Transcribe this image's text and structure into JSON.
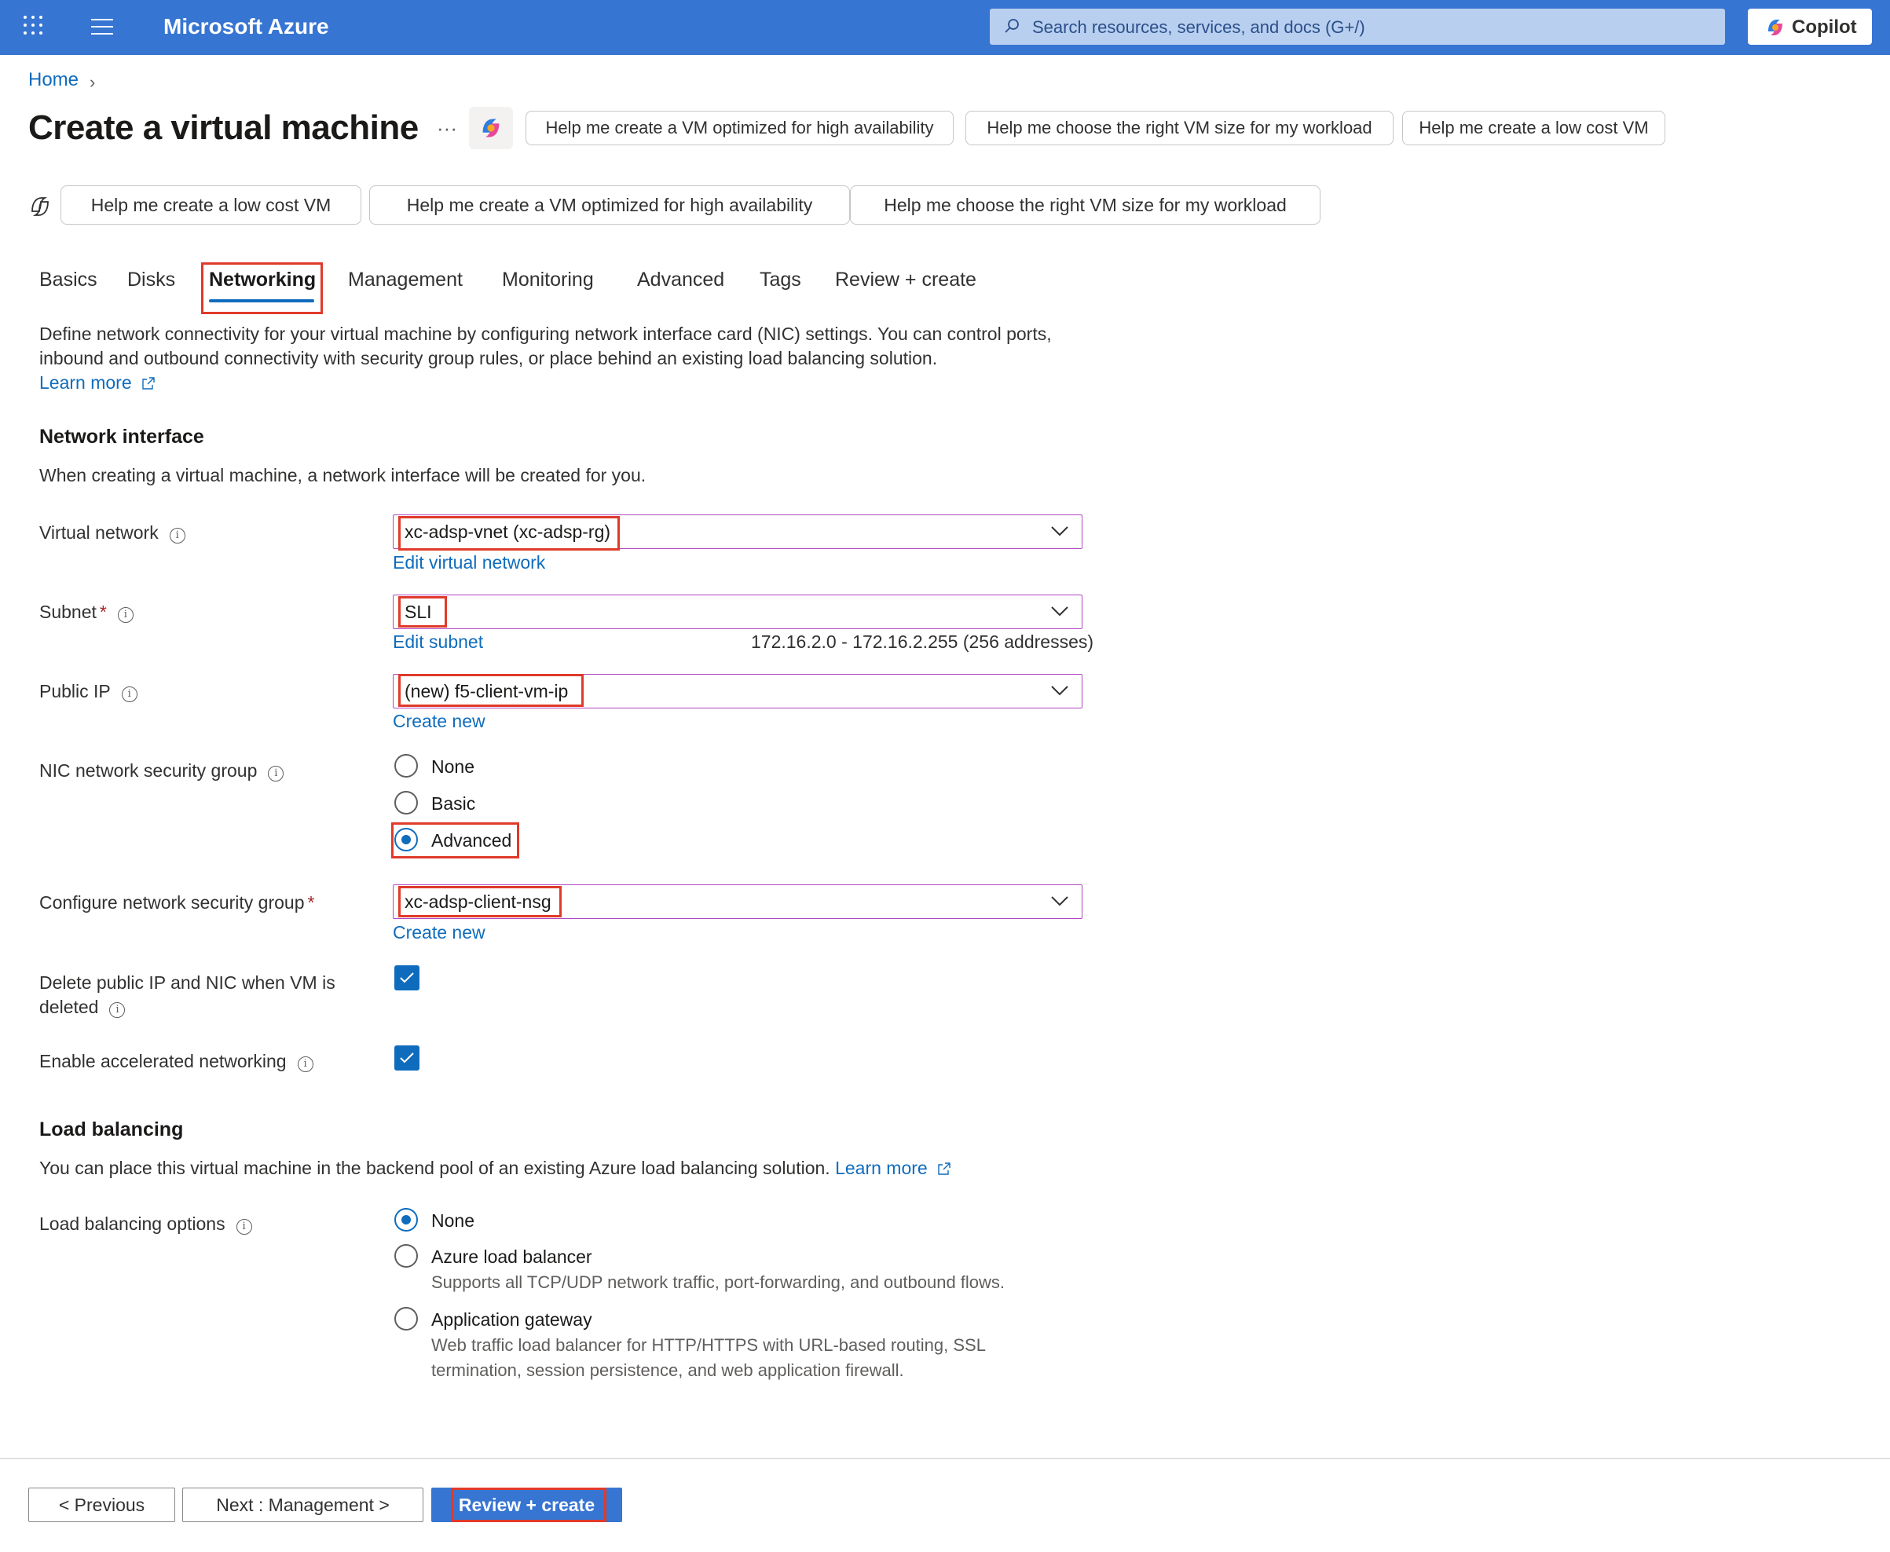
{
  "topbar": {
    "brand": "Microsoft Azure",
    "search_placeholder": "Search resources, services, and docs (G+/)",
    "copilot_label": "Copilot"
  },
  "breadcrumb": {
    "home": "Home"
  },
  "page": {
    "title": "Create a virtual machine",
    "more": "···",
    "suggestions_top": [
      "Help me create a VM optimized for high availability",
      "Help me choose the right VM size for my workload",
      "Help me create a low cost VM"
    ],
    "suggestions_row": [
      "Help me create a low cost VM",
      "Help me create a VM optimized for high availability",
      "Help me choose the right VM size for my workload"
    ]
  },
  "tabs": [
    "Basics",
    "Disks",
    "Networking",
    "Management",
    "Monitoring",
    "Advanced",
    "Tags",
    "Review + create"
  ],
  "active_tab": "Networking",
  "description": {
    "line1": "Define network connectivity for your virtual machine by configuring network interface card (NIC) settings. You can control ports,",
    "line2": "inbound and outbound connectivity with security group rules, or place behind an existing load balancing solution.",
    "learn_more": "Learn more"
  },
  "network_interface": {
    "title": "Network interface",
    "text": "When creating a virtual machine, a network interface will be created for you.",
    "virtual_network": {
      "label": "Virtual network",
      "value": "xc-adsp-vnet (xc-adsp-rg)",
      "link": "Edit virtual network"
    },
    "subnet": {
      "label": "Subnet",
      "value": "SLI",
      "link": "Edit subnet",
      "range": "172.16.2.0 - 172.16.2.255 (256 addresses)"
    },
    "public_ip": {
      "label": "Public IP",
      "value": "(new) f5-client-vm-ip",
      "link": "Create new"
    },
    "nic_nsg": {
      "label": "NIC network security group",
      "options": [
        "None",
        "Basic",
        "Advanced"
      ],
      "selected": "Advanced"
    },
    "configure_nsg": {
      "label": "Configure network security group",
      "value": "xc-adsp-client-nsg",
      "link": "Create new"
    },
    "delete_ip": {
      "label_line1": "Delete public IP and NIC when VM is",
      "label_line2": "deleted",
      "checked": true
    },
    "accelerated": {
      "label": "Enable accelerated networking",
      "checked": true
    }
  },
  "load_balancing": {
    "title": "Load balancing",
    "text": "You can place this virtual machine in the backend pool of an existing Azure load balancing solution.",
    "learn_more": "Learn more",
    "options_label": "Load balancing options",
    "options": [
      {
        "label": "None",
        "desc": ""
      },
      {
        "label": "Azure load balancer",
        "desc": "Supports all TCP/UDP network traffic, port-forwarding, and outbound flows."
      },
      {
        "label": "Application gateway",
        "desc_line1": "Web traffic load balancer for HTTP/HTTPS with URL-based routing, SSL",
        "desc_line2": "termination, session persistence, and web application firewall."
      }
    ],
    "selected": "None"
  },
  "footer": {
    "previous": "< Previous",
    "next": "Next : Management >",
    "review": "Review + create"
  },
  "colors": {
    "topbar": "#3775d2",
    "link": "#0f6cbd",
    "highlight": "#e03a2a"
  }
}
